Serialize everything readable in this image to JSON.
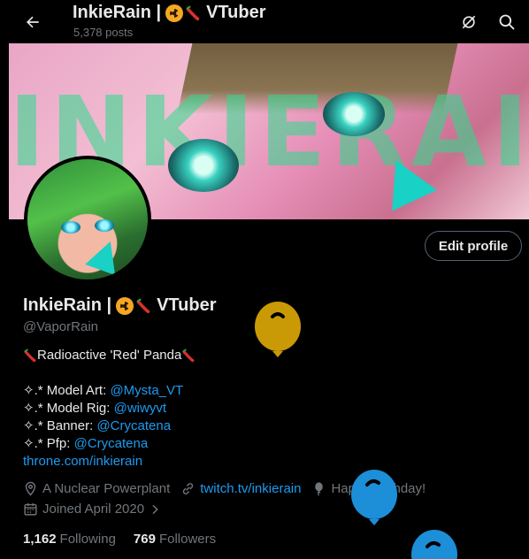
{
  "header": {
    "title_name": "InkieRain |",
    "title_suffix": "VTuber",
    "posts_count": "5,378 posts"
  },
  "profile": {
    "name": "InkieRain |",
    "name_suffix": "VTuber",
    "handle": "@VaporRain",
    "edit_label": "Edit profile"
  },
  "bio": {
    "headline": "Radioactive 'Red' Panda",
    "credits": [
      {
        "prefix": "✧.* Model Art: ",
        "link": "@Mysta_VT"
      },
      {
        "prefix": "✧.* Model Rig: ",
        "link": "@wiwyvt"
      },
      {
        "prefix": "✧.* Banner: ",
        "link": "@Crycatena"
      },
      {
        "prefix": "✧.* Pfp: ",
        "link": "@Crycatena"
      }
    ],
    "website": "throne.com/inkierain"
  },
  "meta": {
    "location": "A Nuclear Powerplant",
    "url": "twitch.tv/inkierain",
    "birthday": "Happy Birthday!",
    "joined": "Joined April 2020"
  },
  "stats": {
    "following_count": "1,162",
    "following_label": "Following",
    "followers_count": "769",
    "followers_label": "Followers"
  },
  "banner": {
    "watermark": "INKIERAIN"
  },
  "colors": {
    "accent": "#1d9bf0",
    "text": "#e7e9ea",
    "muted": "#71767b",
    "background": "#000000",
    "balloon_gold": "#c99a05",
    "balloon_blue": "#1d8ed8"
  },
  "icons": [
    "back-arrow-icon",
    "radioactive-emoji-icon",
    "chili-emoji-icon",
    "no-signal-icon",
    "search-icon",
    "location-icon",
    "link-icon",
    "balloon-icon",
    "calendar-icon",
    "chevron-right-icon"
  ]
}
